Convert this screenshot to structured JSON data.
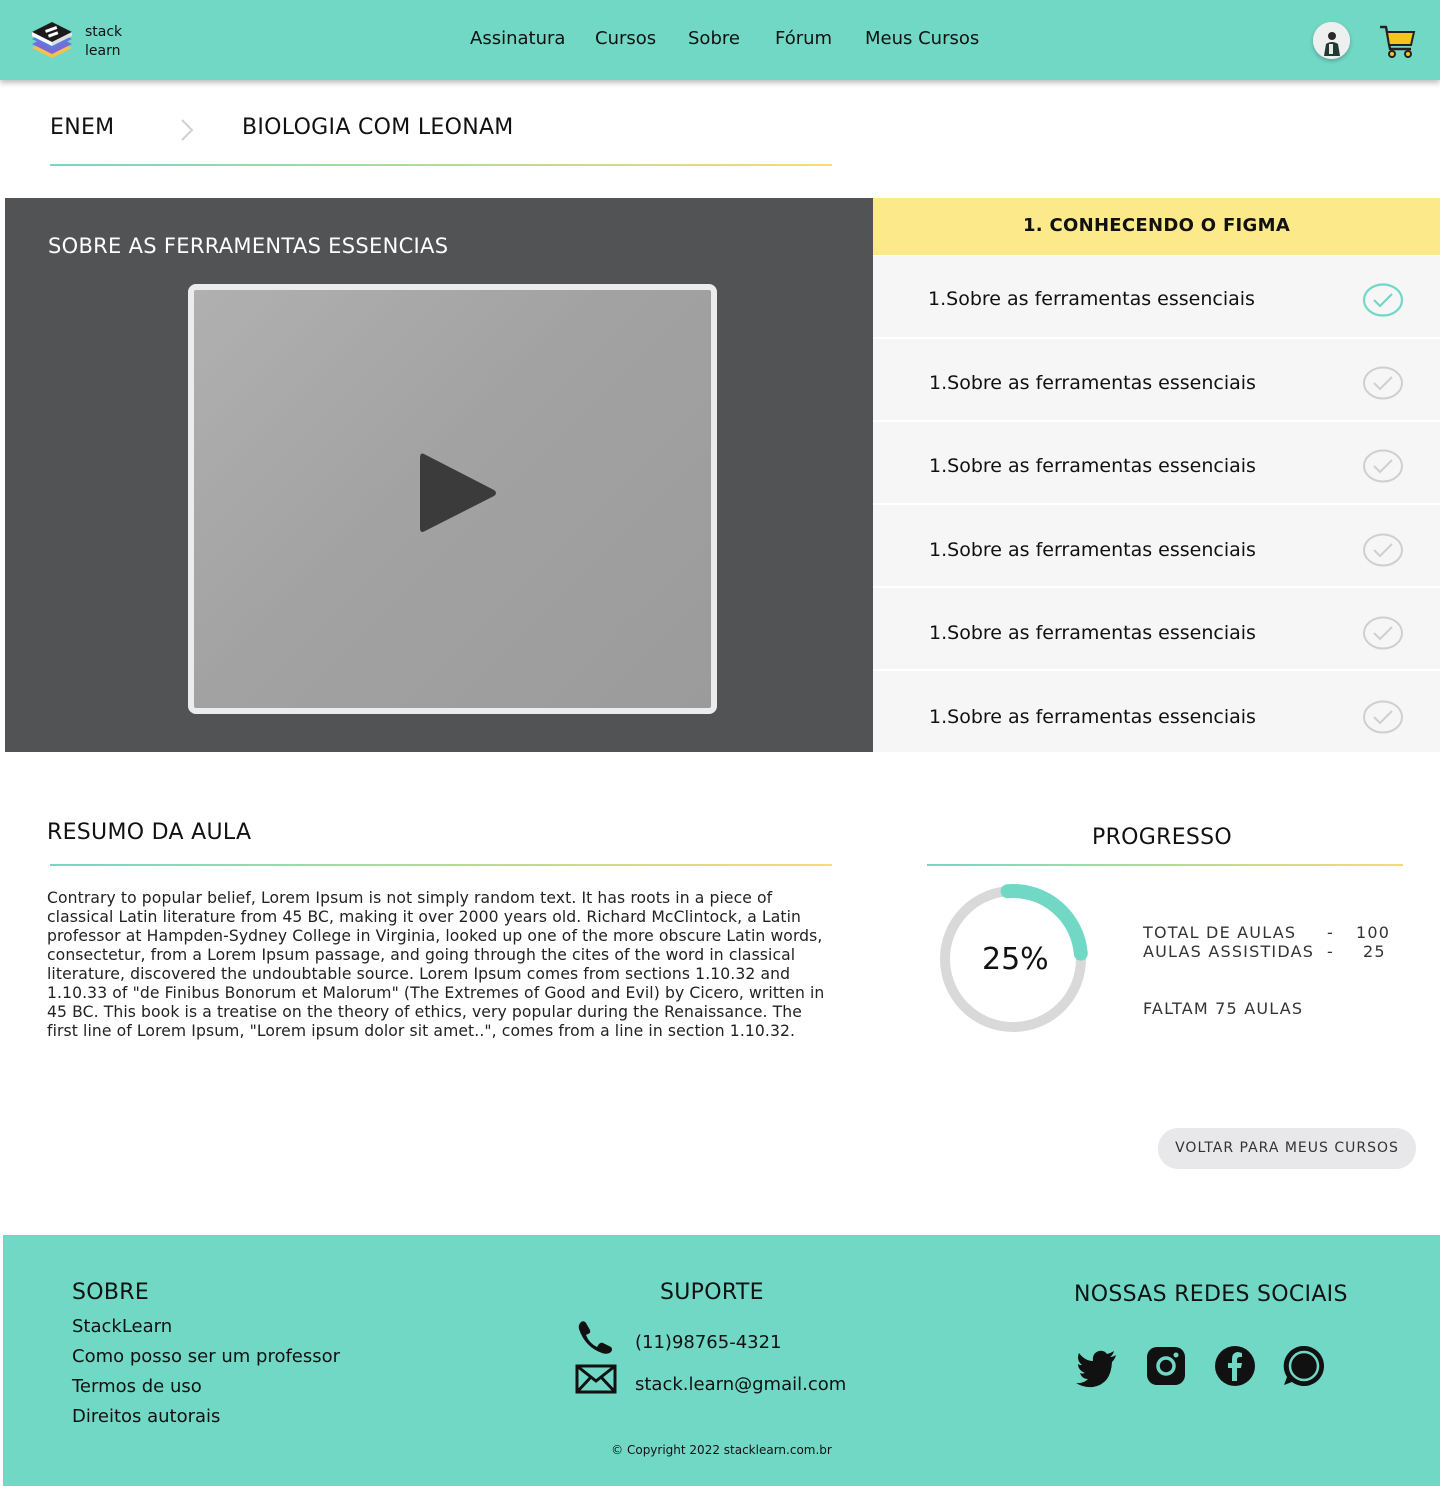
{
  "header": {
    "logo_line1": "stack",
    "logo_line2": "learn",
    "nav": [
      "Assinatura",
      "Cursos",
      "Sobre",
      "Fórum",
      "Meus Cursos"
    ],
    "brand_color": "#72d8c6",
    "cart_color": "#f5c518"
  },
  "breadcrumb": {
    "root": "ENEM",
    "current": "BIOLOGIA COM LEONAM"
  },
  "player": {
    "title": "SOBRE AS FERRAMENTAS ESSENCIAS"
  },
  "module": {
    "title": "1. CONHECENDO O FIGMA",
    "color": "#fbe98a",
    "lessons": [
      {
        "label": "1.Sobre as ferramentas essenciais",
        "completed": true
      },
      {
        "label": "1.Sobre as ferramentas essenciais",
        "completed": false
      },
      {
        "label": "1.Sobre as ferramentas essenciais",
        "completed": false
      },
      {
        "label": "1.Sobre as ferramentas essenciais",
        "completed": false
      },
      {
        "label": "1.Sobre as ferramentas essenciais",
        "completed": false
      },
      {
        "label": "1.Sobre as ferramentas essenciais",
        "completed": false
      }
    ]
  },
  "summary": {
    "title": "RESUMO DA AULA",
    "text": "Contrary to popular belief, Lorem Ipsum is not simply random text. It has roots in a piece of classical Latin literature from 45 BC, making it over 2000 years old. Richard McClintock, a Latin professor at Hampden-Sydney College in Virginia, looked up one of the more obscure Latin words, consectetur, from a Lorem Ipsum passage, and going through the cites of the word in classical literature, discovered the undoubtable source. Lorem Ipsum comes from sections 1.10.32 and 1.10.33 of \"de Finibus Bonorum et Malorum\" (The Extremes of Good and Evil) by Cicero, written in 45 BC. This book is a treatise on the theory of ethics, very popular during the Renaissance. The first line of Lorem Ipsum, \"Lorem ipsum dolor sit amet..\", comes from a line in section 1.10.32."
  },
  "progress": {
    "title": "PROGRESSO",
    "percent_label": "25%",
    "fraction": 0.25,
    "total_label": "TOTAL DE AULAS",
    "total_value": "100",
    "watched_label": "AULAS ASSISTIDAS",
    "watched_value": "25",
    "dash": "-",
    "remaining_label": "FALTAM  75 AULAS",
    "back_button": "VOLTAR PARA MEUS CURSOS"
  },
  "footer": {
    "about_title": "SOBRE",
    "about_links": [
      "StackLearn",
      "Como posso ser um professor",
      "Termos de uso",
      "Direitos autorais"
    ],
    "support_title": "SUPORTE",
    "phone": "(11)98765-4321",
    "email": "stack.learn@gmail.com",
    "social_title": "NOSSAS REDES SOCIAIS",
    "social_icons": [
      "twitter-icon",
      "instagram-icon",
      "facebook-icon",
      "whatsapp-icon"
    ],
    "copyright": "© Copyright 2022 stacklearn.com.br"
  }
}
